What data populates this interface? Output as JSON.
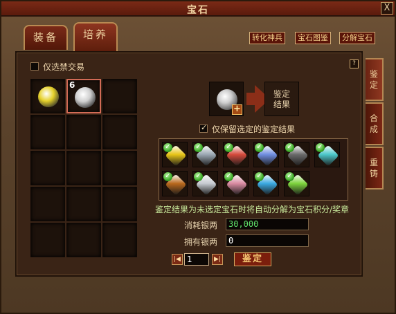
{
  "window": {
    "title": "宝石",
    "close_label": "X"
  },
  "tabs": [
    "装备",
    "培养"
  ],
  "top_buttons": [
    "转化神兵",
    "宝石图鉴",
    "分解宝石"
  ],
  "side_tabs": [
    "鉴定",
    "合成",
    "重铸"
  ],
  "filter": {
    "label": "仅选禁交易",
    "checked": false
  },
  "help_label": "?",
  "inventory": {
    "rows": 5,
    "cols": 3,
    "items": [
      {
        "gem": "yellow-gem",
        "color": "#e6d12a"
      },
      {
        "gem": "white-gem",
        "color": "#cfcfcf",
        "count": "6",
        "selected": true
      }
    ]
  },
  "appraise": {
    "input_gem": "white-gem",
    "plus_label": "+",
    "result_label": "鉴定\n结果",
    "keep_selected": {
      "label": "仅保留选定的鉴定结果",
      "checked": true
    }
  },
  "results": [
    {
      "name": "yellow-gem",
      "color": "#e7c417"
    },
    {
      "name": "silver-crystal",
      "color": "#9aa7b2"
    },
    {
      "name": "red-gem",
      "color": "#d44a3c"
    },
    {
      "name": "crescent-gem",
      "color": "#6f8de0"
    },
    {
      "name": "black-orb",
      "color": "#6a6a6a"
    },
    {
      "name": "cyan-gem",
      "color": "#4bc6c8"
    },
    {
      "name": "amber-gem",
      "color": "#b8681c"
    },
    {
      "name": "silver-pyramid",
      "color": "#c5c9cf"
    },
    {
      "name": "pink-gem",
      "color": "#d88aa0"
    },
    {
      "name": "blue-gem",
      "color": "#3aa8e0"
    },
    {
      "name": "green-gem",
      "color": "#7cd23c"
    }
  ],
  "note": "鉴定结果为未选定宝石时将自动分解为宝石积分/奖章",
  "costs": {
    "consume_label": "消耗银两",
    "consume_value": "30,000",
    "own_label": "拥有银两",
    "own_value": "0"
  },
  "pager": {
    "value": "1",
    "prev_icon": "first-page-icon",
    "next_icon": "last-page-icon"
  },
  "action_button": "鉴定",
  "colors": {
    "note": "#c7e79a",
    "consume": "#5fe06a",
    "own": "#ffffff"
  }
}
